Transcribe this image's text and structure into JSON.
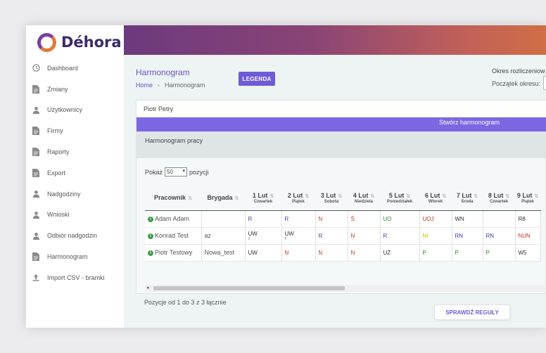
{
  "brand": {
    "name": "Déhora",
    "ring_color": "#7b3fa0",
    "accent": "#e27a3a"
  },
  "sidebar": {
    "items": [
      {
        "label": "Dashboard",
        "icon": "clock-icon"
      },
      {
        "label": "Zmiany",
        "icon": "document-icon"
      },
      {
        "label": "Użytkownicy",
        "icon": "user-icon"
      },
      {
        "label": "Firmy",
        "icon": "document-icon"
      },
      {
        "label": "Raporty",
        "icon": "document-icon"
      },
      {
        "label": "Export",
        "icon": "document-icon"
      },
      {
        "label": "Nadgodziny",
        "icon": "user-icon"
      },
      {
        "label": "Wnioski",
        "icon": "user-icon"
      },
      {
        "label": "Odbiór nadgodzin",
        "icon": "user-icon"
      },
      {
        "label": "Harmonogram",
        "icon": "document-icon"
      },
      {
        "label": "Import CSV - bramki",
        "icon": "upload-icon"
      }
    ]
  },
  "header": {
    "title": "Harmonogram",
    "legend_button": "LEGENDA",
    "breadcrumb": {
      "home": "Home",
      "current": "Harmonogram"
    },
    "period_label": "Okres rozliczeniow",
    "period_start_label": "Początek okresu:"
  },
  "card": {
    "employee_name": "Piotr Petry",
    "create_button": "Stwórz harmonogram",
    "section_title": "Harmonogram pracy",
    "show": {
      "prefix": "Pokaż",
      "value": "50",
      "suffix": "pozycji"
    },
    "columns": {
      "employee": "Pracownik",
      "brigade": "Brygada",
      "days": [
        {
          "date": "1 Lut",
          "day": "Czwartek"
        },
        {
          "date": "2 Lut",
          "day": "Piątek"
        },
        {
          "date": "3 Lut",
          "day": "Sobota"
        },
        {
          "date": "4 Lut",
          "day": "Niedziela"
        },
        {
          "date": "5 Lut",
          "day": "Poniedziałek"
        },
        {
          "date": "6 Lut",
          "day": "Wtorek"
        },
        {
          "date": "7 Lut",
          "day": "Środa"
        },
        {
          "date": "8 Lut",
          "day": "Czwartek"
        },
        {
          "date": "9 Lut",
          "day": "Piątek"
        }
      ]
    },
    "rows": [
      {
        "employee": "Adam Adam",
        "brigade": "",
        "cells": [
          {
            "code": "R",
            "sub": "",
            "color": "#3b3bb0"
          },
          {
            "code": "R",
            "sub": "",
            "color": "#3b3bb0"
          },
          {
            "code": "N",
            "sub": "",
            "color": "#c0392b"
          },
          {
            "code": "Ś",
            "sub": "",
            "color": "#c0392b"
          },
          {
            "code": "UO",
            "sub": "",
            "color": "#2e8b3a"
          },
          {
            "code": "UOJ",
            "sub": "",
            "color": "#c0392b"
          },
          {
            "code": "WN",
            "sub": "",
            "color": "#333333"
          },
          {
            "code": "",
            "sub": "",
            "color": "#333333"
          },
          {
            "code": "R8",
            "sub": "",
            "color": "#333333"
          }
        ]
      },
      {
        "employee": "Konrad Test",
        "brigade": "az",
        "cells": [
          {
            "code": "UW",
            "sub": "8",
            "color": "#333333"
          },
          {
            "code": "UW",
            "sub": "8",
            "color": "#333333"
          },
          {
            "code": "R",
            "sub": "",
            "color": "#3b3bb0"
          },
          {
            "code": "N",
            "sub": "",
            "color": "#c0392b"
          },
          {
            "code": "R",
            "sub": "",
            "color": "#3b3bb0"
          },
          {
            "code": "NI",
            "sub": "",
            "color": "#c9b400"
          },
          {
            "code": "RN",
            "sub": "",
            "color": "#3b3bb0"
          },
          {
            "code": "RN",
            "sub": "",
            "color": "#3b3bb0"
          },
          {
            "code": "NUN",
            "sub": "",
            "color": "#c0392b"
          }
        ]
      },
      {
        "employee": "Piotr Testowy",
        "brigade": "Nowa_test",
        "cells": [
          {
            "code": "UW",
            "sub": "",
            "color": "#333333"
          },
          {
            "code": "N",
            "sub": "",
            "color": "#c0392b"
          },
          {
            "code": "N",
            "sub": "",
            "color": "#c0392b"
          },
          {
            "code": "N",
            "sub": "",
            "color": "#c0392b"
          },
          {
            "code": "UŻ",
            "sub": "",
            "color": "#333333"
          },
          {
            "code": "P",
            "sub": "",
            "color": "#2e8b3a"
          },
          {
            "code": "P",
            "sub": "",
            "color": "#2e8b3a"
          },
          {
            "code": "P",
            "sub": "",
            "color": "#2e8b3a"
          },
          {
            "code": "W5",
            "sub": "",
            "color": "#333333"
          }
        ]
      }
    ],
    "position_info": "Pozycje od 1 do 3 z 3 łącznie"
  },
  "rules_button": "SPRAWDŹ REGUŁY"
}
